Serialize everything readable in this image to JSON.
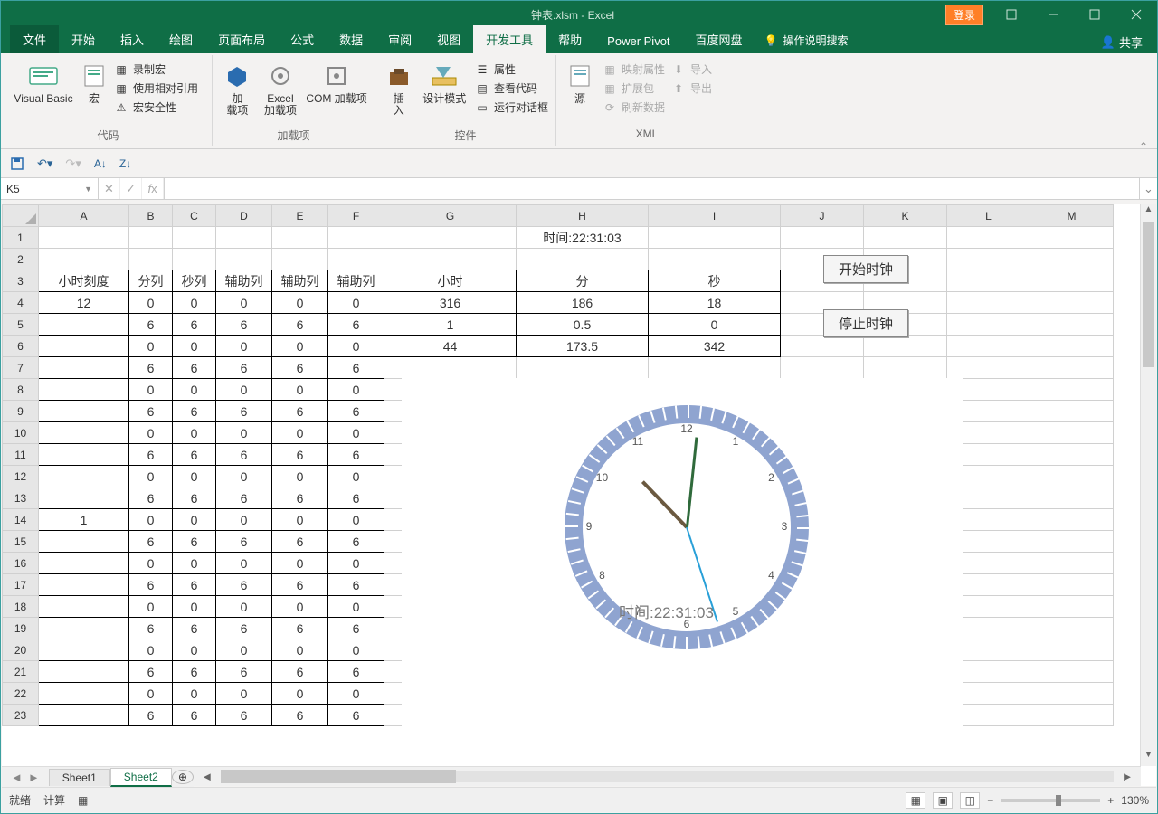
{
  "title": "钟表.xlsm - Excel",
  "login_label": "登录",
  "share_label": "共享",
  "tell_me": "操作说明搜索",
  "menus": [
    "文件",
    "开始",
    "插入",
    "绘图",
    "页面布局",
    "公式",
    "数据",
    "审阅",
    "视图",
    "开发工具",
    "帮助",
    "Power Pivot",
    "百度网盘"
  ],
  "active_menu_index": 9,
  "ribbon": {
    "group1": {
      "label": "代码",
      "vb_big": "Visual Basic",
      "macro_big": "宏",
      "items": [
        "录制宏",
        "使用相对引用",
        "宏安全性"
      ]
    },
    "group2": {
      "label": "加载项",
      "addin_big": "加\n载项",
      "excel_addin_big": "Excel\n加载项",
      "com_addin_big": "COM 加载项"
    },
    "group3": {
      "label": "控件",
      "insert_big": "插\n入",
      "design_big": "设计模式",
      "items": [
        "属性",
        "查看代码",
        "运行对话框"
      ]
    },
    "group4": {
      "label": "XML",
      "source_big": "源",
      "items_left": [
        "映射属性",
        "扩展包",
        "刷新数据"
      ],
      "items_right": [
        "导入",
        "导出"
      ]
    }
  },
  "name_box": "K5",
  "grid": {
    "columns": [
      "A",
      "B",
      "C",
      "D",
      "E",
      "F",
      "G",
      "H",
      "I",
      "J",
      "K",
      "L",
      "M"
    ],
    "time_cell": "时间:22:31:03",
    "headers": [
      "小时刻度",
      "分列",
      "秒列",
      "辅助列",
      "辅助列",
      "辅助列",
      "小时",
      "分",
      "秒"
    ],
    "rows": [
      [
        "12",
        "0",
        "0",
        "0",
        "0",
        "0",
        "316",
        "186",
        "18"
      ],
      [
        "",
        "6",
        "6",
        "6",
        "6",
        "6",
        "1",
        "0.5",
        "0"
      ],
      [
        "",
        "0",
        "0",
        "0",
        "0",
        "0",
        "44",
        "173.5",
        "342"
      ],
      [
        "",
        "6",
        "6",
        "6",
        "6",
        "6"
      ],
      [
        "",
        "0",
        "0",
        "0",
        "0",
        "0"
      ],
      [
        "",
        "6",
        "6",
        "6",
        "6",
        "6"
      ],
      [
        "",
        "0",
        "0",
        "0",
        "0",
        "0"
      ],
      [
        "",
        "6",
        "6",
        "6",
        "6",
        "6"
      ],
      [
        "",
        "0",
        "0",
        "0",
        "0",
        "0"
      ],
      [
        "",
        "6",
        "6",
        "6",
        "6",
        "6"
      ],
      [
        "1",
        "0",
        "0",
        "0",
        "0",
        "0"
      ],
      [
        "",
        "6",
        "6",
        "6",
        "6",
        "6"
      ],
      [
        "",
        "0",
        "0",
        "0",
        "0",
        "0"
      ],
      [
        "",
        "6",
        "6",
        "6",
        "6",
        "6"
      ],
      [
        "",
        "0",
        "0",
        "0",
        "0",
        "0"
      ],
      [
        "",
        "6",
        "6",
        "6",
        "6",
        "6"
      ],
      [
        "",
        "0",
        "0",
        "0",
        "0",
        "0"
      ],
      [
        "",
        "6",
        "6",
        "6",
        "6",
        "6"
      ],
      [
        "",
        "0",
        "0",
        "0",
        "0",
        "0"
      ],
      [
        "",
        "6",
        "6",
        "6",
        "6",
        "6"
      ]
    ],
    "row_start": 4
  },
  "buttons": {
    "start": "开始时钟",
    "stop": "停止时钟"
  },
  "sheet_tabs": [
    "Sheet1",
    "Sheet2"
  ],
  "active_sheet": 1,
  "status": {
    "ready": "就绪",
    "calc": "计算",
    "zoom": "130%"
  },
  "clock_label": "时间:22:31:03",
  "chart_data": {
    "type": "pie",
    "title": "时间:22:31:03",
    "hour_angle": 316,
    "minute_angle": 186,
    "second_angle": 18,
    "clock_numbers": [
      "12",
      "1",
      "2",
      "3",
      "4",
      "5",
      "6",
      "7",
      "8",
      "9",
      "10",
      "11"
    ]
  }
}
